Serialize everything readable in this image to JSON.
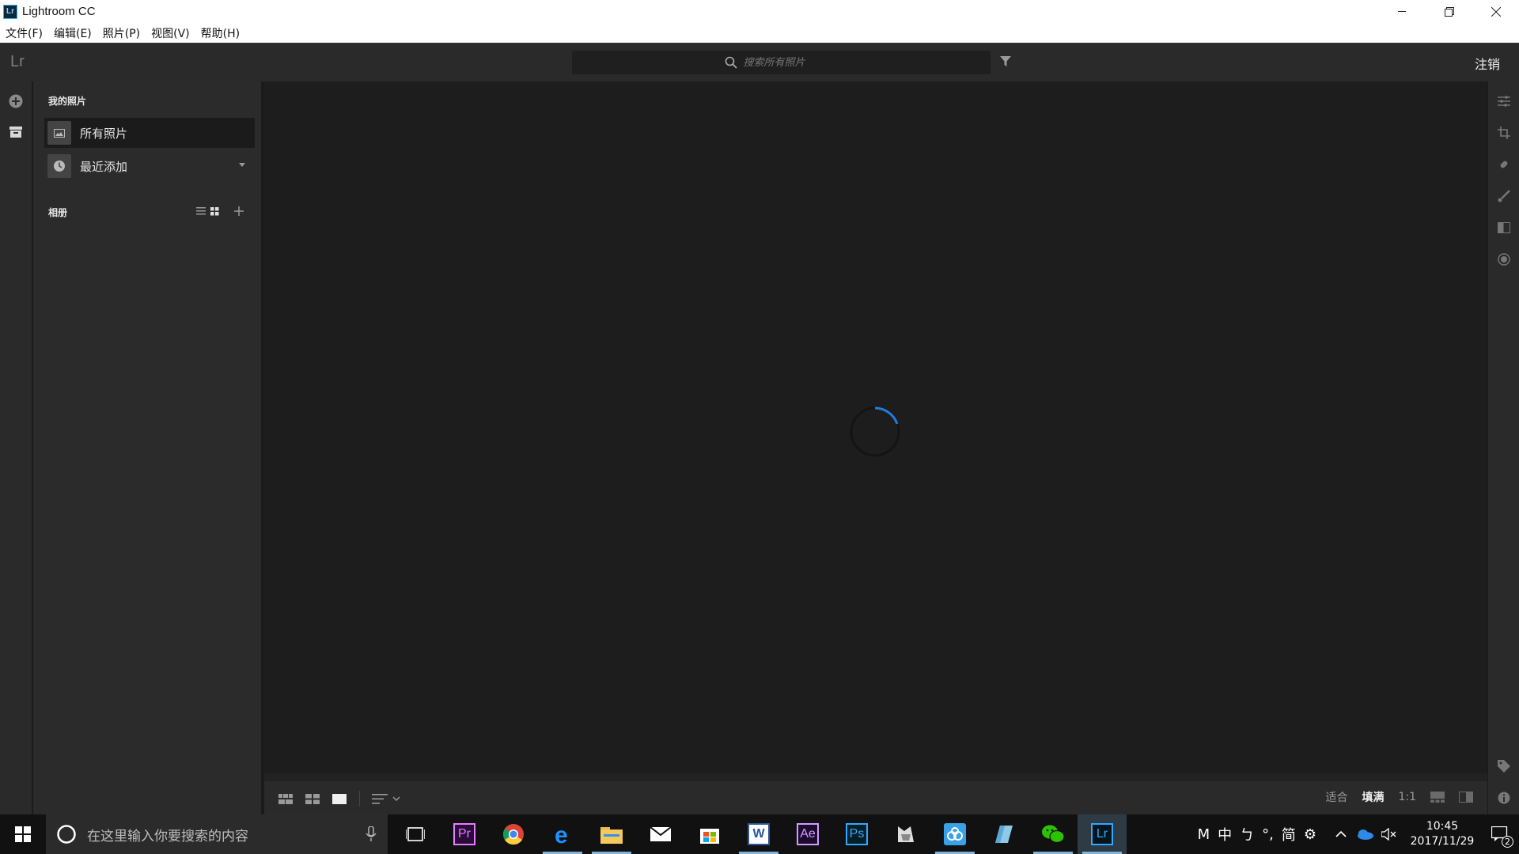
{
  "window": {
    "title": "Lightroom CC",
    "icon_text": "Lr"
  },
  "menu": [
    "文件(F)",
    "编辑(E)",
    "照片(P)",
    "视图(V)",
    "帮助(H)"
  ],
  "topbar": {
    "logo": "Lr",
    "search_placeholder": "搜索所有照片",
    "logout": "注销"
  },
  "sidebar": {
    "my_photos_title": "我的照片",
    "items": [
      {
        "label": "所有照片",
        "icon": "photo-icon",
        "active": true
      },
      {
        "label": "最近添加",
        "icon": "clock-icon",
        "active": false
      }
    ],
    "albums_title": "相册"
  },
  "bottombar": {
    "zoom": [
      {
        "label": "适合",
        "on": false
      },
      {
        "label": "填满",
        "on": true
      },
      {
        "label": "1:1",
        "on": false
      }
    ]
  },
  "taskbar": {
    "search_placeholder": "在这里输入你要搜索的内容",
    "apps": [
      {
        "name": "task-view",
        "running": false
      },
      {
        "name": "premiere",
        "label": "Pr",
        "color": "#e77cff",
        "running": false
      },
      {
        "name": "chrome",
        "running": false
      },
      {
        "name": "edge",
        "running": true
      },
      {
        "name": "file-explorer",
        "running": true
      },
      {
        "name": "mail",
        "running": false
      },
      {
        "name": "store",
        "running": false
      },
      {
        "name": "word",
        "label": "W",
        "color": "#2b579a",
        "running": true
      },
      {
        "name": "after-effects",
        "label": "Ae",
        "color": "#d39bff",
        "running": false
      },
      {
        "name": "photoshop",
        "label": "Ps",
        "color": "#31a8ff",
        "running": false
      },
      {
        "name": "app-cat",
        "running": false
      },
      {
        "name": "baidu-netdisk",
        "running": true
      },
      {
        "name": "app-blue",
        "running": false
      },
      {
        "name": "wechat",
        "running": true
      },
      {
        "name": "lightroom",
        "label": "Lr",
        "color": "#31a8ff",
        "running": true
      }
    ],
    "ime": [
      "M",
      "中",
      "ㄅ",
      "°,",
      "简",
      "⚙"
    ],
    "time": "10:45",
    "date": "2017/11/29",
    "notifications": "2"
  }
}
